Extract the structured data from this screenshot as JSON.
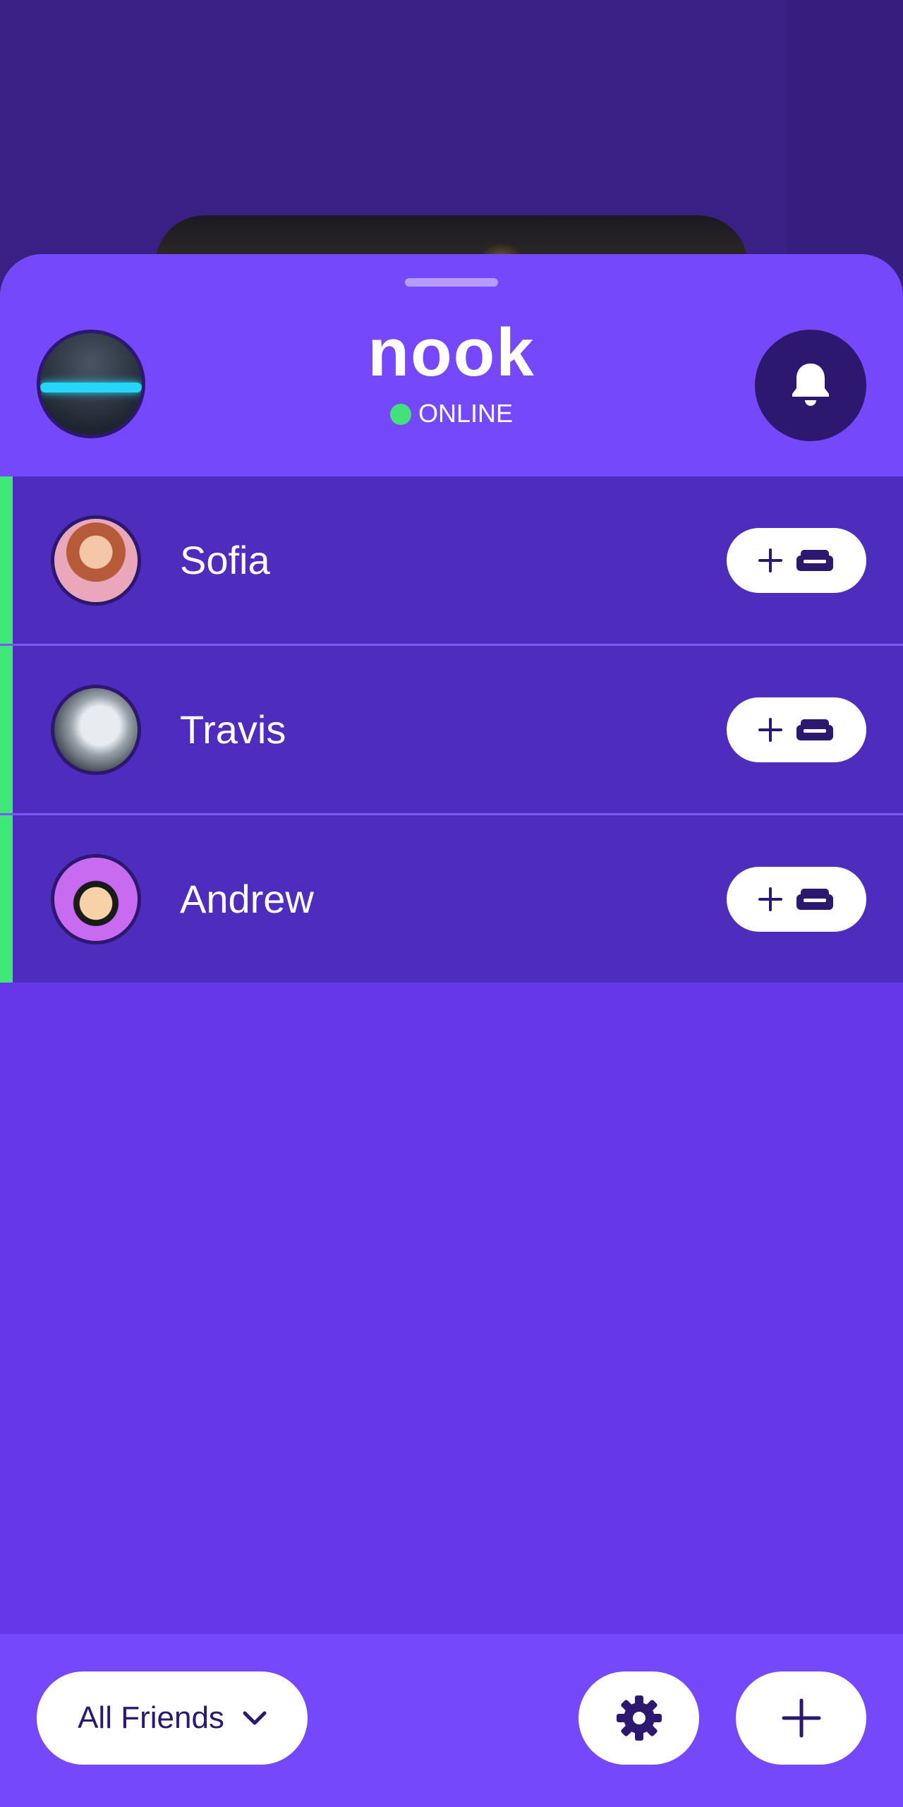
{
  "app": {
    "name": "nook",
    "status": "ONLINE",
    "status_color": "#43e17a"
  },
  "colors": {
    "sheet": "#6537e8",
    "header": "#7549fb",
    "row": "#4e2cbd",
    "accent": "#3fe678",
    "dark": "#2d1870"
  },
  "friends": [
    {
      "name": "Sofia",
      "avatar_icon": "cartoon-girl-avatar",
      "action_icon": "add-to-couch-icon"
    },
    {
      "name": "Travis",
      "avatar_icon": "white-dragon-avatar",
      "action_icon": "add-to-couch-icon"
    },
    {
      "name": "Andrew",
      "avatar_icon": "cartoon-boy-avatar",
      "action_icon": "add-to-couch-icon"
    }
  ],
  "bottom": {
    "filter_label": "All Friends",
    "filter_icon": "chevron-down-icon",
    "settings_icon": "gear-icon",
    "add_icon": "plus-icon"
  }
}
